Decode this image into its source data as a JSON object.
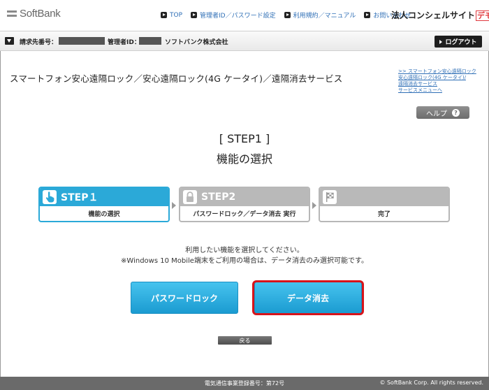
{
  "header": {
    "logo_text": "SoftBank",
    "links": [
      {
        "label": "TOP"
      },
      {
        "label": "管理者ID／パスワード設定"
      },
      {
        "label": "利用規約／マニュアル"
      },
      {
        "label": "お問い合わせ"
      }
    ],
    "site_title": "法人コンシェルサイト",
    "demo_badge": "デモ"
  },
  "account_bar": {
    "billing_label": "請求先番号：",
    "admin_label": "管理者ID：",
    "company": "ソフトバンク株式会社",
    "logout_label": "ログアウト"
  },
  "page": {
    "title": "スマートフォン安心遠隔ロック／安心遠隔ロック(4G ケータイ)／遠隔消去サービス",
    "side_links": [
      ">> スマートフォン安心遠隔ロック",
      "安心遠隔ロック(4G ケータイ)/",
      "遠隔消去サービス",
      "サービスメニューへ"
    ],
    "help_label": "ヘルプ"
  },
  "step_heading": "[ STEP1 ]",
  "step_subheading": "機能の選択",
  "steps": [
    {
      "name": "STEP１",
      "desc": "機能の選択",
      "active": true,
      "icon": "hand-pointer-icon"
    },
    {
      "name": "STEP2",
      "desc": "パスワードロック／データ消去 実行",
      "active": false,
      "icon": "lock-icon"
    },
    {
      "name": "",
      "desc": "完了",
      "active": false,
      "icon": "checkered-flag-icon"
    }
  ],
  "instructions": [
    "利用したい機能を選択してください。",
    "※Windows 10 Mobile端末をご利用の場合は、データ消去のみ選択可能です。"
  ],
  "buttons": {
    "password_lock": "パスワードロック",
    "data_erase": "データ消去",
    "back": "戻る"
  },
  "footer": {
    "registration": "電気通信事業登録番号：第72号",
    "copyright": "© SoftBank Corp. All rights reserved."
  },
  "colors": {
    "accent_blue": "#2ba9d8",
    "link_blue": "#2f6fb6",
    "highlight_red": "#d7141a",
    "demo_red": "#e0393e"
  }
}
